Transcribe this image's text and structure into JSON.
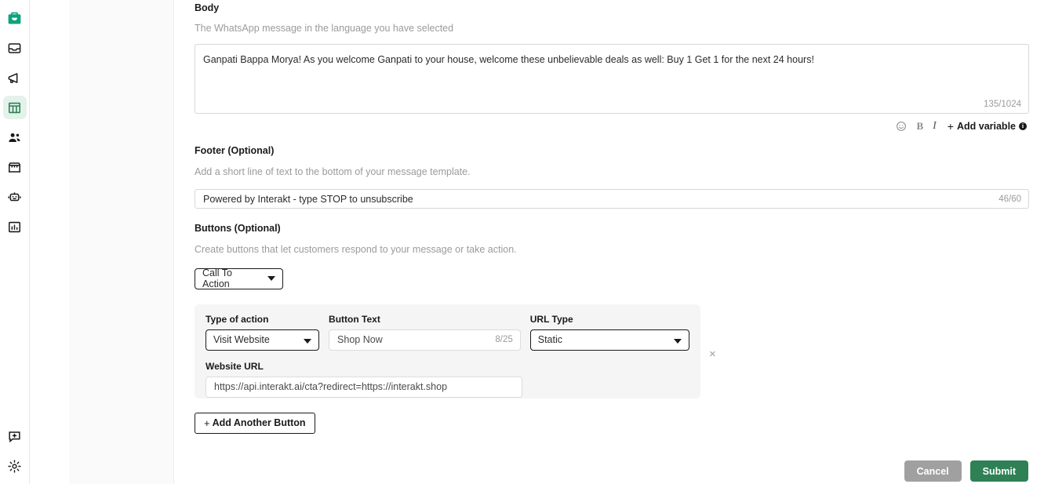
{
  "sidebar": {
    "items": [
      {
        "name": "logo",
        "icon": "briefcase-icon",
        "active": false
      },
      {
        "name": "inbox",
        "icon": "inbox-icon",
        "active": false
      },
      {
        "name": "campaigns",
        "icon": "megaphone-icon",
        "active": false
      },
      {
        "name": "templates",
        "icon": "table-icon",
        "active": true
      },
      {
        "name": "contacts",
        "icon": "people-icon",
        "active": false
      },
      {
        "name": "catalog",
        "icon": "storefront-icon",
        "active": false
      },
      {
        "name": "automation",
        "icon": "robot-icon",
        "active": false
      },
      {
        "name": "analytics",
        "icon": "bar-chart-icon",
        "active": false
      }
    ],
    "bottom_items": [
      {
        "name": "feedback",
        "icon": "chat-plus-icon"
      },
      {
        "name": "settings",
        "icon": "gear-icon"
      }
    ]
  },
  "body_section": {
    "title": "Body",
    "description": "The WhatsApp message in the language you have selected",
    "value": "Ganpati Bappa Morya! As you welcome Ganpati to your house, welcome these unbelievable deals as well: Buy 1 Get 1 for the next 24 hours!",
    "counter": "135/1024",
    "toolbar": {
      "emoji_icon": "emoji-smiley-icon",
      "bold_label": "B",
      "italic_label": "I",
      "add_variable_plus": "+",
      "add_variable_label": "Add variable",
      "info_label": "i"
    }
  },
  "footer_section": {
    "title": "Footer (Optional)",
    "description": "Add a short line of text to the bottom of your message template.",
    "value": "Powered by Interakt - type STOP to unsubscribe",
    "counter": "46/60"
  },
  "buttons_section": {
    "title": "Buttons (Optional)",
    "description": "Create buttons that let customers respond to your message or take action.",
    "type_selected": "Call To Action",
    "add_another_plus": "+",
    "add_another_label": "Add Another Button",
    "button_card": {
      "action_label": "Type of action",
      "action_value": "Visit Website",
      "text_label": "Button Text",
      "text_value": "Shop Now",
      "text_counter": "8/25",
      "urltype_label": "URL Type",
      "urltype_value": "Static",
      "url_label": "Website URL",
      "url_value": "https://api.interakt.ai/cta?redirect=https://interakt.shop",
      "remove_icon": "×"
    }
  },
  "actions": {
    "cancel_label": "Cancel",
    "submit_label": "Submit"
  },
  "colors": {
    "brand_teal": "#0da37f",
    "active_green": "#2f8055",
    "active_bg": "#e3f2ea",
    "submit_green": "#2f8055",
    "cancel_gray": "#a0a0a0",
    "panel_gray": "#fafafa",
    "card_gray": "#f5f5f5"
  }
}
